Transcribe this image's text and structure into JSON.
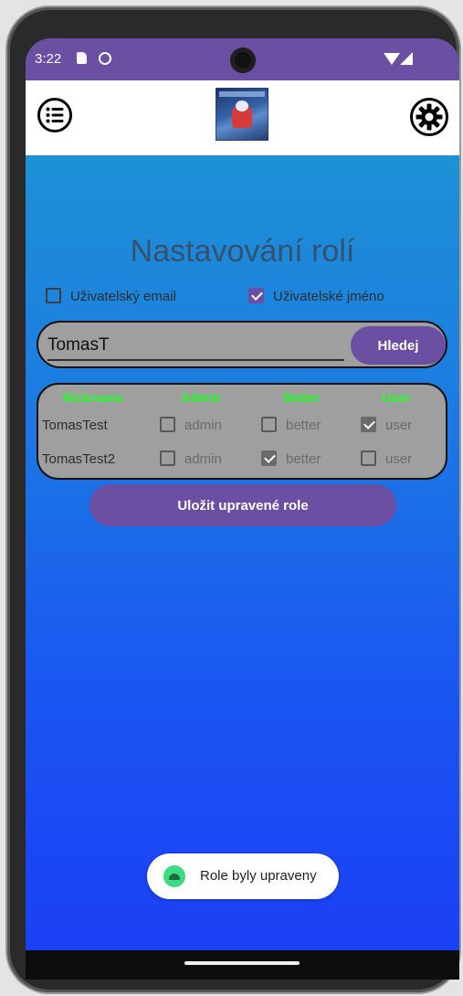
{
  "status_bar": {
    "time": "3:22"
  },
  "app": {
    "logo_alt": "App logo",
    "title": "Nastavování rolí"
  },
  "filters": {
    "email_label": "Uživatelský email",
    "email_checked": false,
    "username_label": "Uživatelské jméno",
    "username_checked": true
  },
  "search": {
    "value": "TomasT",
    "button_label": "Hledej"
  },
  "roles_table": {
    "headers": [
      "Nickname",
      "Admin",
      "Better",
      "User"
    ],
    "rows": [
      {
        "nickname": "TomasTest",
        "admin_label": "admin",
        "admin": false,
        "better_label": "better",
        "better": false,
        "user_label": "user",
        "user": true
      },
      {
        "nickname": "TomasTest2",
        "admin_label": "admin",
        "admin": false,
        "better_label": "better",
        "better": true,
        "user_label": "user",
        "user": false
      }
    ]
  },
  "save_button_label": "Uložit upravené role",
  "toast": {
    "text": "Role byly upraveny"
  },
  "colors": {
    "accent": "#6b4fa3",
    "header_text": "#22ff22",
    "panel": "#9f9f9f",
    "gradient_top": "#1e9ad0",
    "gradient_bottom": "#1b3df5"
  }
}
